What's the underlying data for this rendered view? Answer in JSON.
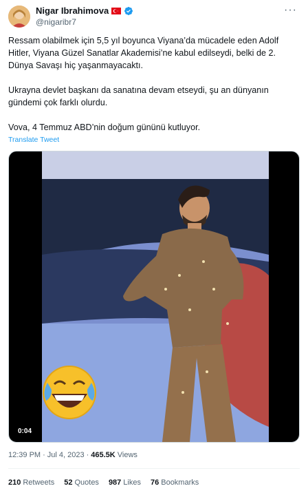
{
  "author": {
    "display_name": "Nigar Ibrahimova",
    "handle": "@nigaribr7",
    "flag": "turkey-flag-icon",
    "verified": "verified-badge-icon"
  },
  "tweet": {
    "paragraphs": [
      "Ressam olabilmek için 5,5 yıl boyunca Viyana’da mücadele eden Adolf Hitler, Viyana Güzel Sanatlar Akademisi’ne kabul edilseydi, belki de 2. Dünya Savaşı hiç yaşanmayacaktı.",
      "Ukrayna devlet başkanı da sanatına devam etseydi, şu an dünyanın gündemi çok farklı olurdu.",
      "Vova, 4 Temmuz ABD’nin doğum gününü kutluyor."
    ],
    "translate_label": "Translate Tweet"
  },
  "media": {
    "duration": "0:04",
    "overlay_emoji": "😂"
  },
  "meta": {
    "time": "12:39 PM",
    "separator": "·",
    "date": "Jul 4, 2023",
    "views_count": "465.5K",
    "views_label": "Views"
  },
  "stats": {
    "retweets_count": "210",
    "retweets_label": "Retweets",
    "quotes_count": "52",
    "quotes_label": "Quotes",
    "likes_count": "987",
    "likes_label": "Likes",
    "bookmarks_count": "76",
    "bookmarks_label": "Bookmarks"
  },
  "colors": {
    "link": "#1d9bf0",
    "secondary_text": "#536471",
    "primary_text": "#0f1419",
    "flag_red": "#e30a17"
  }
}
